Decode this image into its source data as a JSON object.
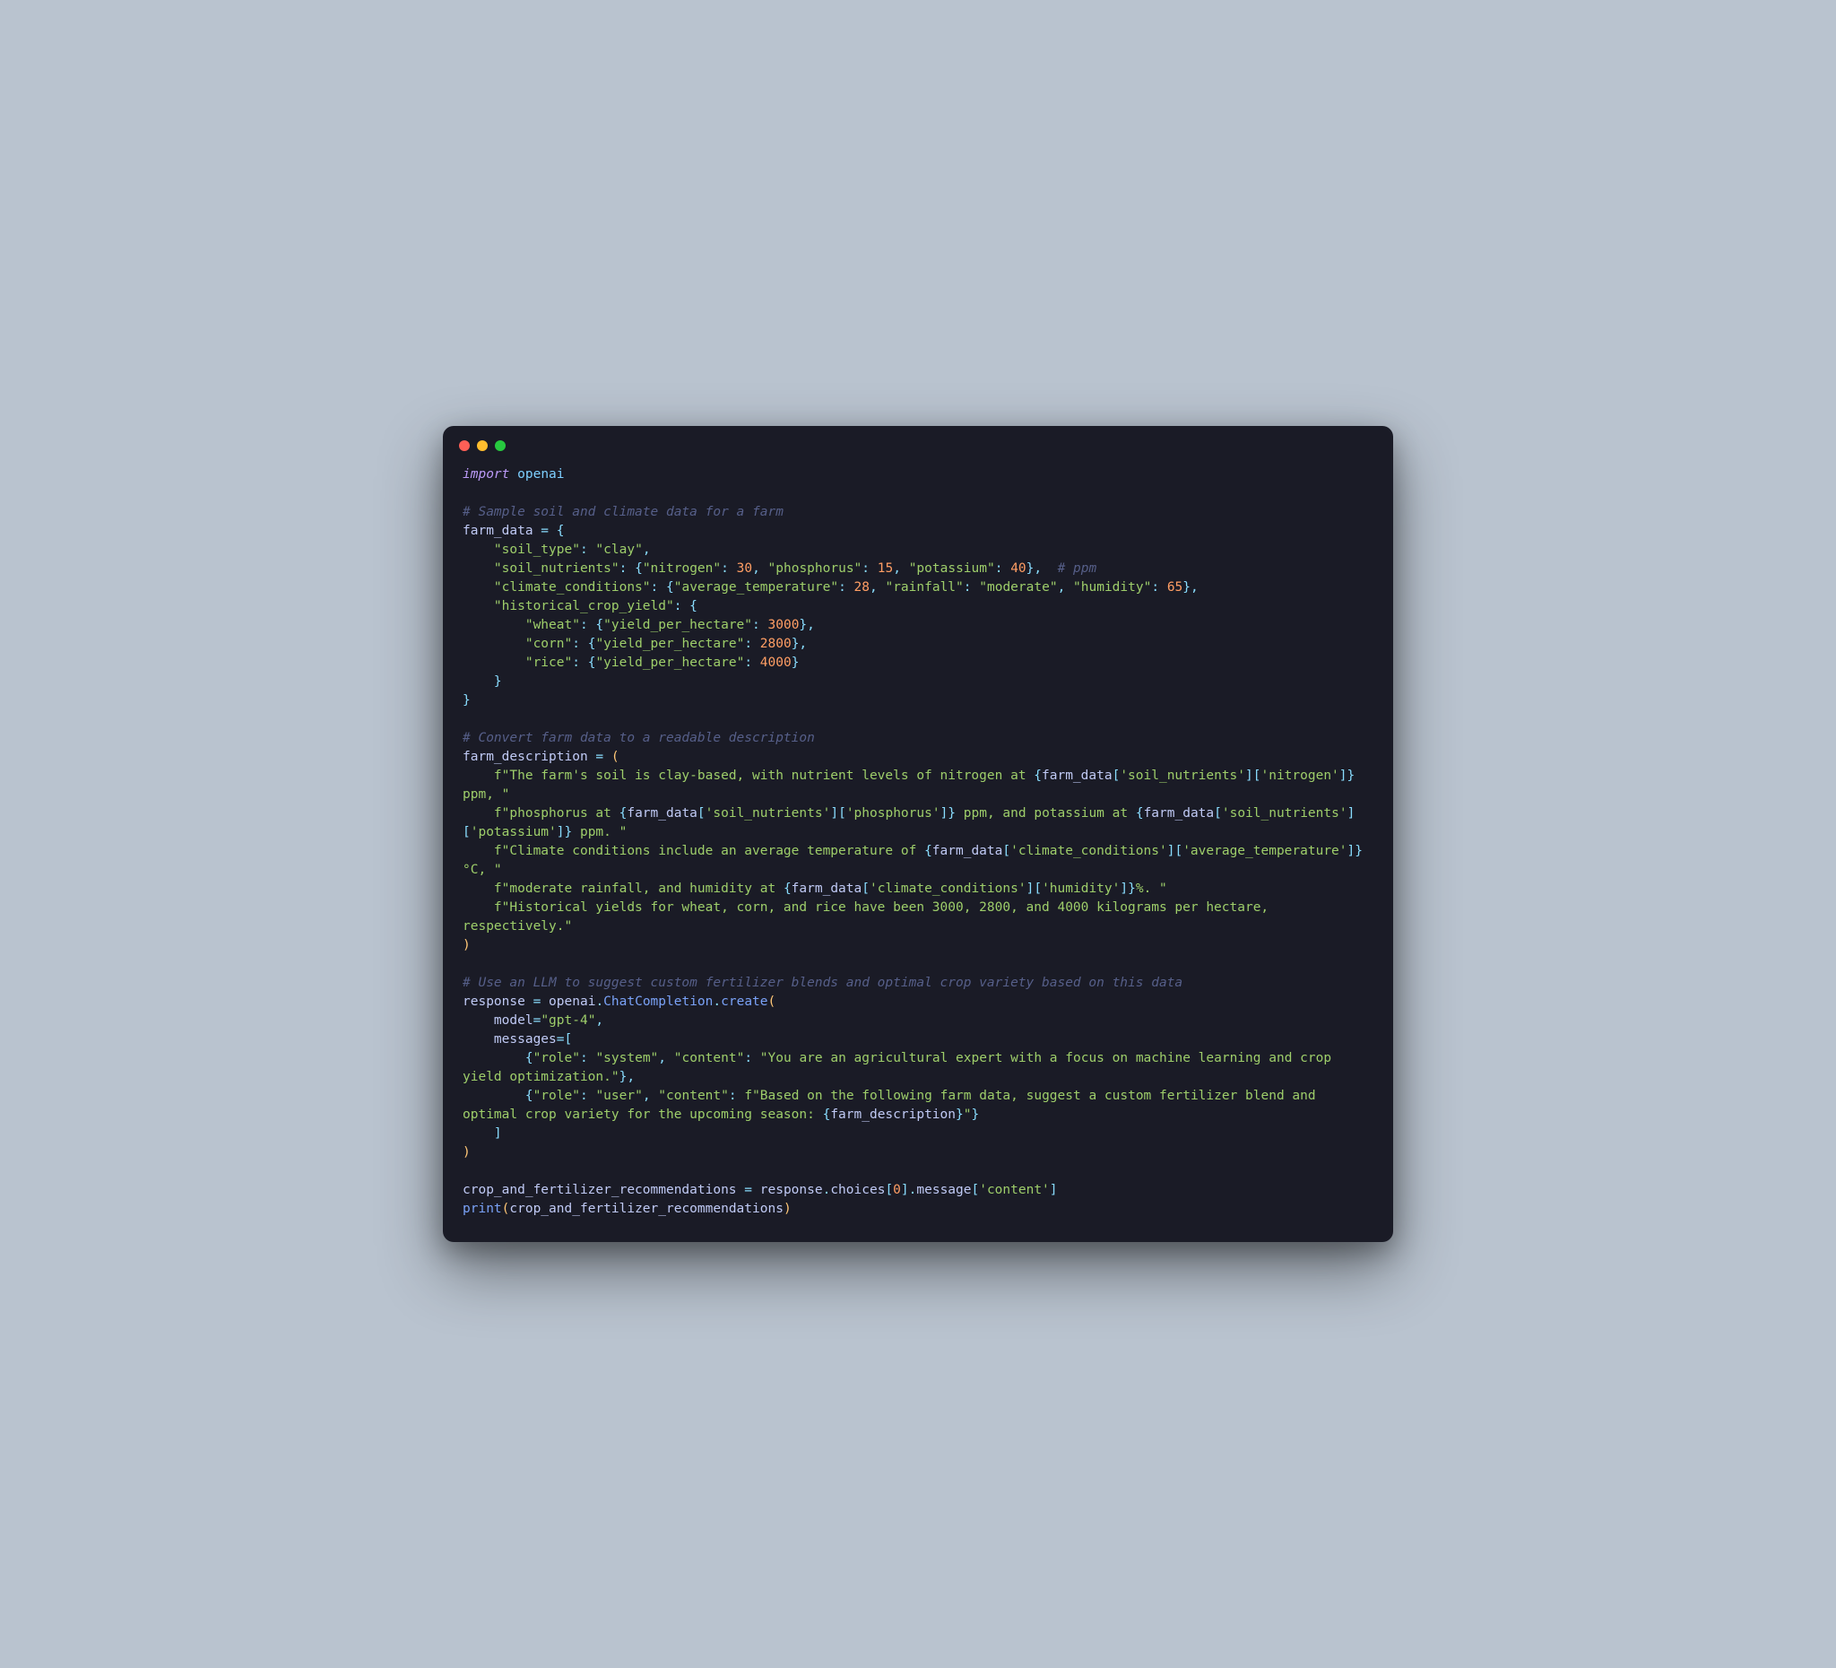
{
  "traffic_lights": {
    "red": "#ff5f56",
    "yellow": "#ffbd2e",
    "green": "#27c93f"
  },
  "code": {
    "l01_import": "import",
    "l01_openai": "openai",
    "l03_comment": "# Sample soil and climate data for a farm",
    "l04_var": "farm_data",
    "l04_eq": " = ",
    "l04_brace": "{",
    "l05_key": "\"soil_type\"",
    "l05_val": "\"clay\"",
    "l06_key": "\"soil_nutrients\"",
    "l06_k1": "\"nitrogen\"",
    "l06_v1": "30",
    "l06_k2": "\"phosphorus\"",
    "l06_v2": "15",
    "l06_k3": "\"potassium\"",
    "l06_v3": "40",
    "l06_comment": "# ppm",
    "l07_key": "\"climate_conditions\"",
    "l07_k1": "\"average_temperature\"",
    "l07_v1": "28",
    "l07_k2": "\"rainfall\"",
    "l07_v2": "\"moderate\"",
    "l07_k3": "\"humidity\"",
    "l07_v3": "65",
    "l08_key": "\"historical_crop_yield\"",
    "l09_k": "\"wheat\"",
    "l09_ik": "\"yield_per_hectare\"",
    "l09_iv": "3000",
    "l10_k": "\"corn\"",
    "l10_ik": "\"yield_per_hectare\"",
    "l10_iv": "2800",
    "l11_k": "\"rice\"",
    "l11_ik": "\"yield_per_hectare\"",
    "l11_iv": "4000",
    "l15_comment": "# Convert farm data to a readable description",
    "l16_var": "farm_description",
    "l17_pref": "    f\"The farm's soil is clay-based, with nutrient levels of nitrogen at ",
    "l17_intp_open": "{",
    "l17_fd": "farm_data",
    "l17_k1": "'soil_nutrients'",
    "l17_k2": "'nitrogen'",
    "l17_intp_close": "}",
    "l17_suf": " ppm, \"",
    "l18_pref": "    f\"phosphorus at ",
    "l18_k1": "'soil_nutrients'",
    "l18_k2": "'phosphorus'",
    "l18_mid": " ppm, and potassium at ",
    "l18b_k1": "'soil_nutrients'",
    "l18b_k2": "'potassium'",
    "l18_suf": " ppm. \"",
    "l19_pref": "    f\"Climate conditions include an average temperature of ",
    "l19_k1": "'climate_conditions'",
    "l19_k2": "'average_temperature'",
    "l19_suf": "°C, \"",
    "l20_pref": "    f\"moderate rainfall, and humidity at ",
    "l20_k1": "'climate_conditions'",
    "l20_k2": "'humidity'",
    "l20_suf": "%. \"",
    "l21_line": "    f\"Historical yields for wheat, corn, and rice have been 3000, 2800, and 4000 kilograms per hectare, respectively.\"",
    "l24_comment": "# Use an LLM to suggest custom fertilizer blends and optimal crop variety based on this data",
    "l25_var": "response",
    "l25_openai": "openai",
    "l25_cc": "ChatCompletion",
    "l25_create": "create",
    "l26_model_k": "model",
    "l26_model_v": "\"gpt-4\"",
    "l27_messages": "messages",
    "l28_role_k": "\"role\"",
    "l28_role_v": "\"system\"",
    "l28_content_k": "\"content\"",
    "l28_content_v": "\"You are an agricultural expert with a focus on machine learning and crop yield optimization.\"",
    "l29_role_v": "\"user\"",
    "l29_content_pref": "f\"Based on the following farm data, suggest a custom fertilizer blend and optimal crop variety for the upcoming season: ",
    "l29_intp": "farm_description",
    "l29_content_suf": "\"",
    "l33_var": "crop_and_fertilizer_recommendations",
    "l33_choices": "choices",
    "l33_idx": "0",
    "l33_message": "message",
    "l33_key": "'content'",
    "l34_print": "print"
  }
}
